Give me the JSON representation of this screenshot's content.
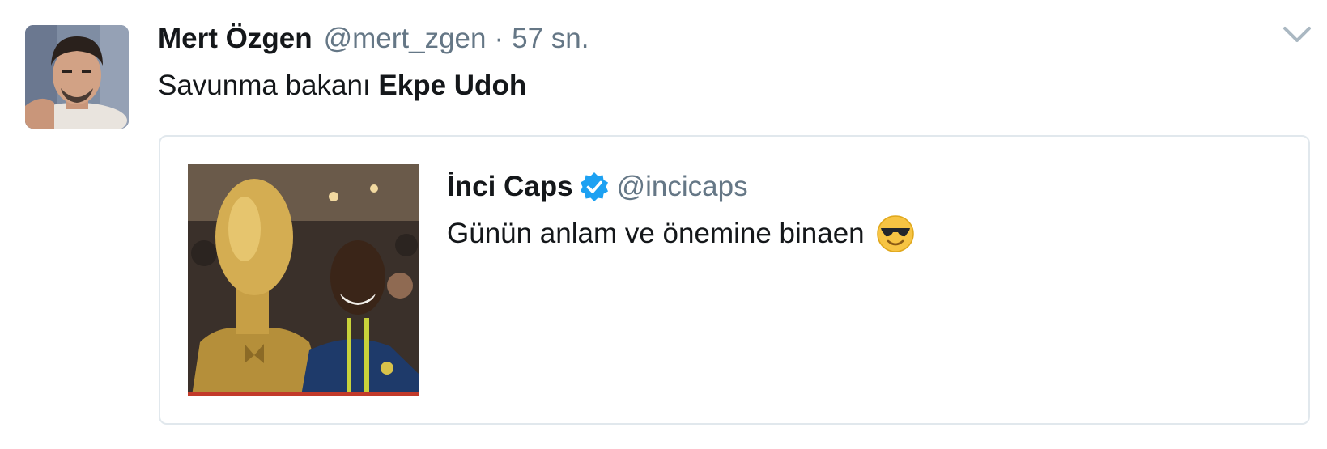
{
  "tweet": {
    "author": {
      "name": "Mert Özgen",
      "handle": "@mert_zgen",
      "avatar": "profile-photo"
    },
    "separator": "·",
    "timestamp": "57 sn.",
    "text_prefix": "Savunma bakanı ",
    "text_bold": "Ekpe Udoh",
    "menu_icon": "chevron-down-icon"
  },
  "quoted_tweet": {
    "name": "İnci Caps",
    "verified": true,
    "verified_icon": "verified-badge-icon",
    "handle": "@incicaps",
    "text": "Günün anlam ve önemine binaen",
    "emoji": "smiling-face-with-sunglasses",
    "media": "photo-bust-and-player"
  },
  "colors": {
    "primary_text": "#14171a",
    "secondary_text": "#657786",
    "border": "#e1e8ed",
    "verified_blue": "#1da1f2"
  }
}
